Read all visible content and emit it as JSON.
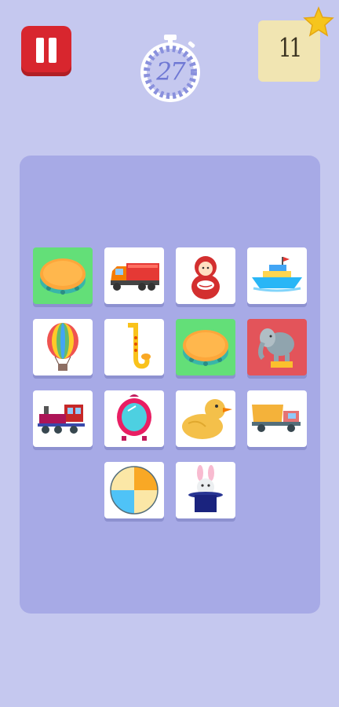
{
  "hud": {
    "pause_icon": "pause-icon",
    "timer_value": "27",
    "score_value": "11",
    "accent_color": "#d8262e",
    "timer_color": "#6f78d4",
    "score_bg": "#f1e5b2"
  },
  "board": {
    "background": "#a7aae6",
    "cards": [
      {
        "icon": "tambourine",
        "state": "matched"
      },
      {
        "icon": "truck",
        "state": "face-up"
      },
      {
        "icon": "roly-poly-doll",
        "state": "face-up"
      },
      {
        "icon": "boat",
        "state": "face-up"
      },
      {
        "icon": "hot-air-balloon",
        "state": "face-up"
      },
      {
        "icon": "saxophone",
        "state": "face-up"
      },
      {
        "icon": "tambourine",
        "state": "matched"
      },
      {
        "icon": "elephant",
        "state": "wrong"
      },
      {
        "icon": "train",
        "state": "face-up"
      },
      {
        "icon": "mirror",
        "state": "face-up"
      },
      {
        "icon": "rubber-duck",
        "state": "face-up"
      },
      {
        "icon": "dump-truck",
        "state": "face-up"
      },
      {
        "icon": "beach-ball",
        "state": "face-up"
      },
      {
        "icon": "magic-hat-rabbit",
        "state": "face-up"
      }
    ]
  }
}
